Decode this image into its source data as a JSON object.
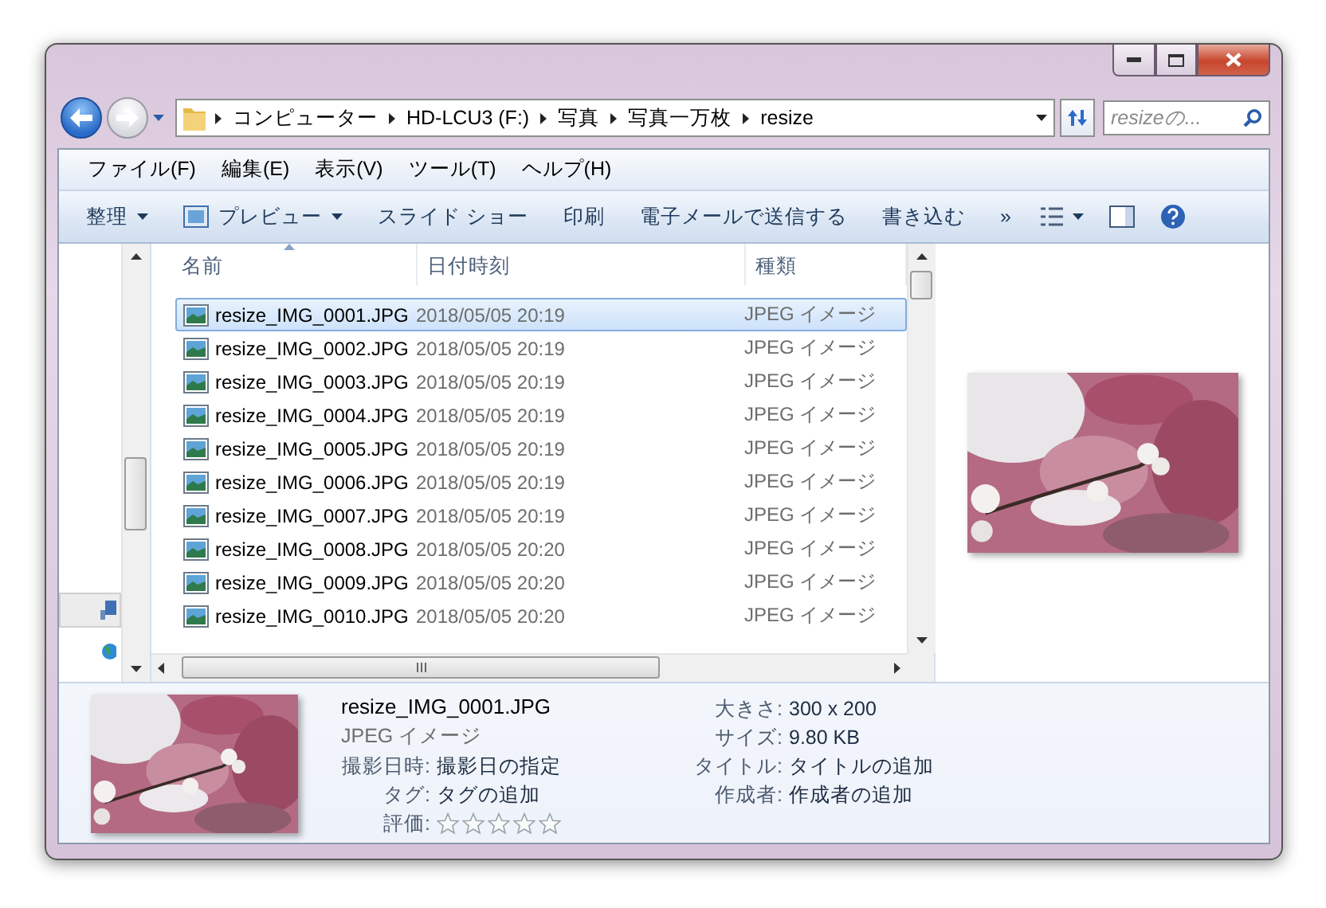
{
  "address": {
    "breadcrumbs": [
      "コンピューター",
      "HD-LCU3 (F:)",
      "写真",
      "写真一万枚",
      "resize"
    ],
    "search_placeholder": "resizeの..."
  },
  "menu": [
    "ファイル(F)",
    "編集(E)",
    "表示(V)",
    "ツール(T)",
    "ヘルプ(H)"
  ],
  "commands": [
    {
      "label": "整理",
      "kind": "plain",
      "dropdown": true
    },
    {
      "label": "プレビュー",
      "kind": "with_icon",
      "dropdown": true
    },
    {
      "label": "スライド ショー",
      "kind": "plain",
      "dropdown": false
    },
    {
      "label": "印刷",
      "kind": "plain",
      "dropdown": false
    },
    {
      "label": "電子メールで送信する",
      "kind": "plain",
      "dropdown": false
    },
    {
      "label": "書き込む",
      "kind": "plain",
      "dropdown": false
    },
    {
      "label": "»",
      "kind": "plain",
      "dropdown": false
    }
  ],
  "columns": [
    {
      "label": "名前",
      "sorted": true
    },
    {
      "label": "日付時刻",
      "sorted": false
    },
    {
      "label": "種類",
      "sorted": false
    }
  ],
  "rows": [
    {
      "name": "resize_IMG_0001.JPG",
      "date": "2018/05/05 20:19",
      "type": "JPEG イメージ",
      "selected": true
    },
    {
      "name": "resize_IMG_0002.JPG",
      "date": "2018/05/05 20:19",
      "type": "JPEG イメージ",
      "selected": false
    },
    {
      "name": "resize_IMG_0003.JPG",
      "date": "2018/05/05 20:19",
      "type": "JPEG イメージ",
      "selected": false
    },
    {
      "name": "resize_IMG_0004.JPG",
      "date": "2018/05/05 20:19",
      "type": "JPEG イメージ",
      "selected": false
    },
    {
      "name": "resize_IMG_0005.JPG",
      "date": "2018/05/05 20:19",
      "type": "JPEG イメージ",
      "selected": false
    },
    {
      "name": "resize_IMG_0006.JPG",
      "date": "2018/05/05 20:19",
      "type": "JPEG イメージ",
      "selected": false
    },
    {
      "name": "resize_IMG_0007.JPG",
      "date": "2018/05/05 20:19",
      "type": "JPEG イメージ",
      "selected": false
    },
    {
      "name": "resize_IMG_0008.JPG",
      "date": "2018/05/05 20:20",
      "type": "JPEG イメージ",
      "selected": false
    },
    {
      "name": "resize_IMG_0009.JPG",
      "date": "2018/05/05 20:20",
      "type": "JPEG イメージ",
      "selected": false
    },
    {
      "name": "resize_IMG_0010.JPG",
      "date": "2018/05/05 20:20",
      "type": "JPEG イメージ",
      "selected": false
    }
  ],
  "details": {
    "name": "resize_IMG_0001.JPG",
    "type": "JPEG イメージ",
    "left_fields": [
      {
        "label": "撮影日時:",
        "value": "撮影日の指定"
      },
      {
        "label": "タグ:",
        "value": "タグの追加"
      }
    ],
    "rating": {
      "label": "評価:",
      "stars": 0
    },
    "right_fields": [
      {
        "label": "大きさ:",
        "value": "300 x 200"
      },
      {
        "label": "サイズ:",
        "value": "9.80 KB"
      },
      {
        "label": "タイトル:",
        "value": "タイトルの追加"
      },
      {
        "label": "作成者:",
        "value": "作成者の追加"
      }
    ]
  }
}
